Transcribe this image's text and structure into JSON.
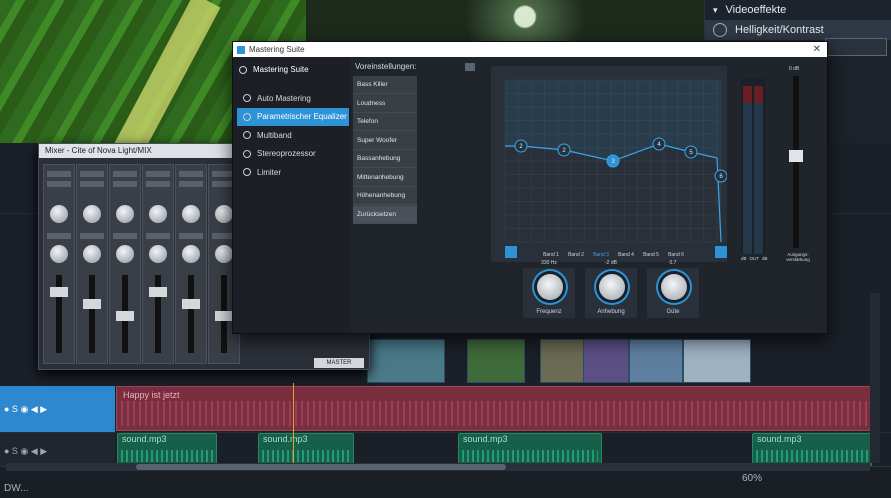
{
  "effects_panel": {
    "items": [
      {
        "label": "Videoeffekte",
        "icon": "chevron-down-icon"
      },
      {
        "label": "Helligkeit/Kontrast",
        "icon": "brightness-icon"
      }
    ]
  },
  "right_panel": {
    "filename": "s7runstach.jpg"
  },
  "mixer": {
    "title": "Mixer - Cite of Nova Light/MIX",
    "master_label": "MASTER"
  },
  "suite": {
    "window_title": "Mastering Suite",
    "header": "Mastering Suite",
    "nav": [
      {
        "label": "Auto Mastering",
        "icon": "gear-icon"
      },
      {
        "label": "Parametrischer Equalizer",
        "icon": "gear-icon"
      },
      {
        "label": "Multiband",
        "icon": "gear-icon"
      },
      {
        "label": "Stereoprozessor",
        "icon": "gear-icon"
      },
      {
        "label": "Limiter",
        "icon": "gear-icon"
      }
    ],
    "presets_label": "Voreinstellungen:",
    "presets": [
      "Bass Killer",
      "Loudness",
      "Telefon",
      "Super Woofer",
      "Bassanhebung",
      "Mittenanhebung",
      "Höhenanhebung",
      "Zurücksetzen"
    ],
    "bands": [
      "Band 1",
      "Band 2",
      "Band 3",
      "Band 4",
      "Band 5",
      "Band 6"
    ],
    "active_band": "Band 3",
    "knobs": [
      {
        "value": "330 Hz",
        "label": "Frequenz"
      },
      {
        "value": "-2 dB",
        "label": "Anhebung"
      },
      {
        "value": "0.7",
        "label": "Güte"
      }
    ],
    "meter_labels": [
      "dB",
      "OUT",
      "dB"
    ],
    "output_label": "Ausgangs-verstärkung",
    "output_value": "0 dB"
  },
  "timeline": {
    "music_clip": "Happy ist jetzt",
    "audio_clips": [
      "sound.mp3",
      "sound.mp3",
      "sound.mp3",
      "sound.mp3"
    ],
    "zoom": "60%"
  },
  "bottom": {
    "status": "DW..."
  },
  "colors": {
    "accent": "#2d93d6",
    "music": "#7a2e3f",
    "audio": "#16604a"
  }
}
